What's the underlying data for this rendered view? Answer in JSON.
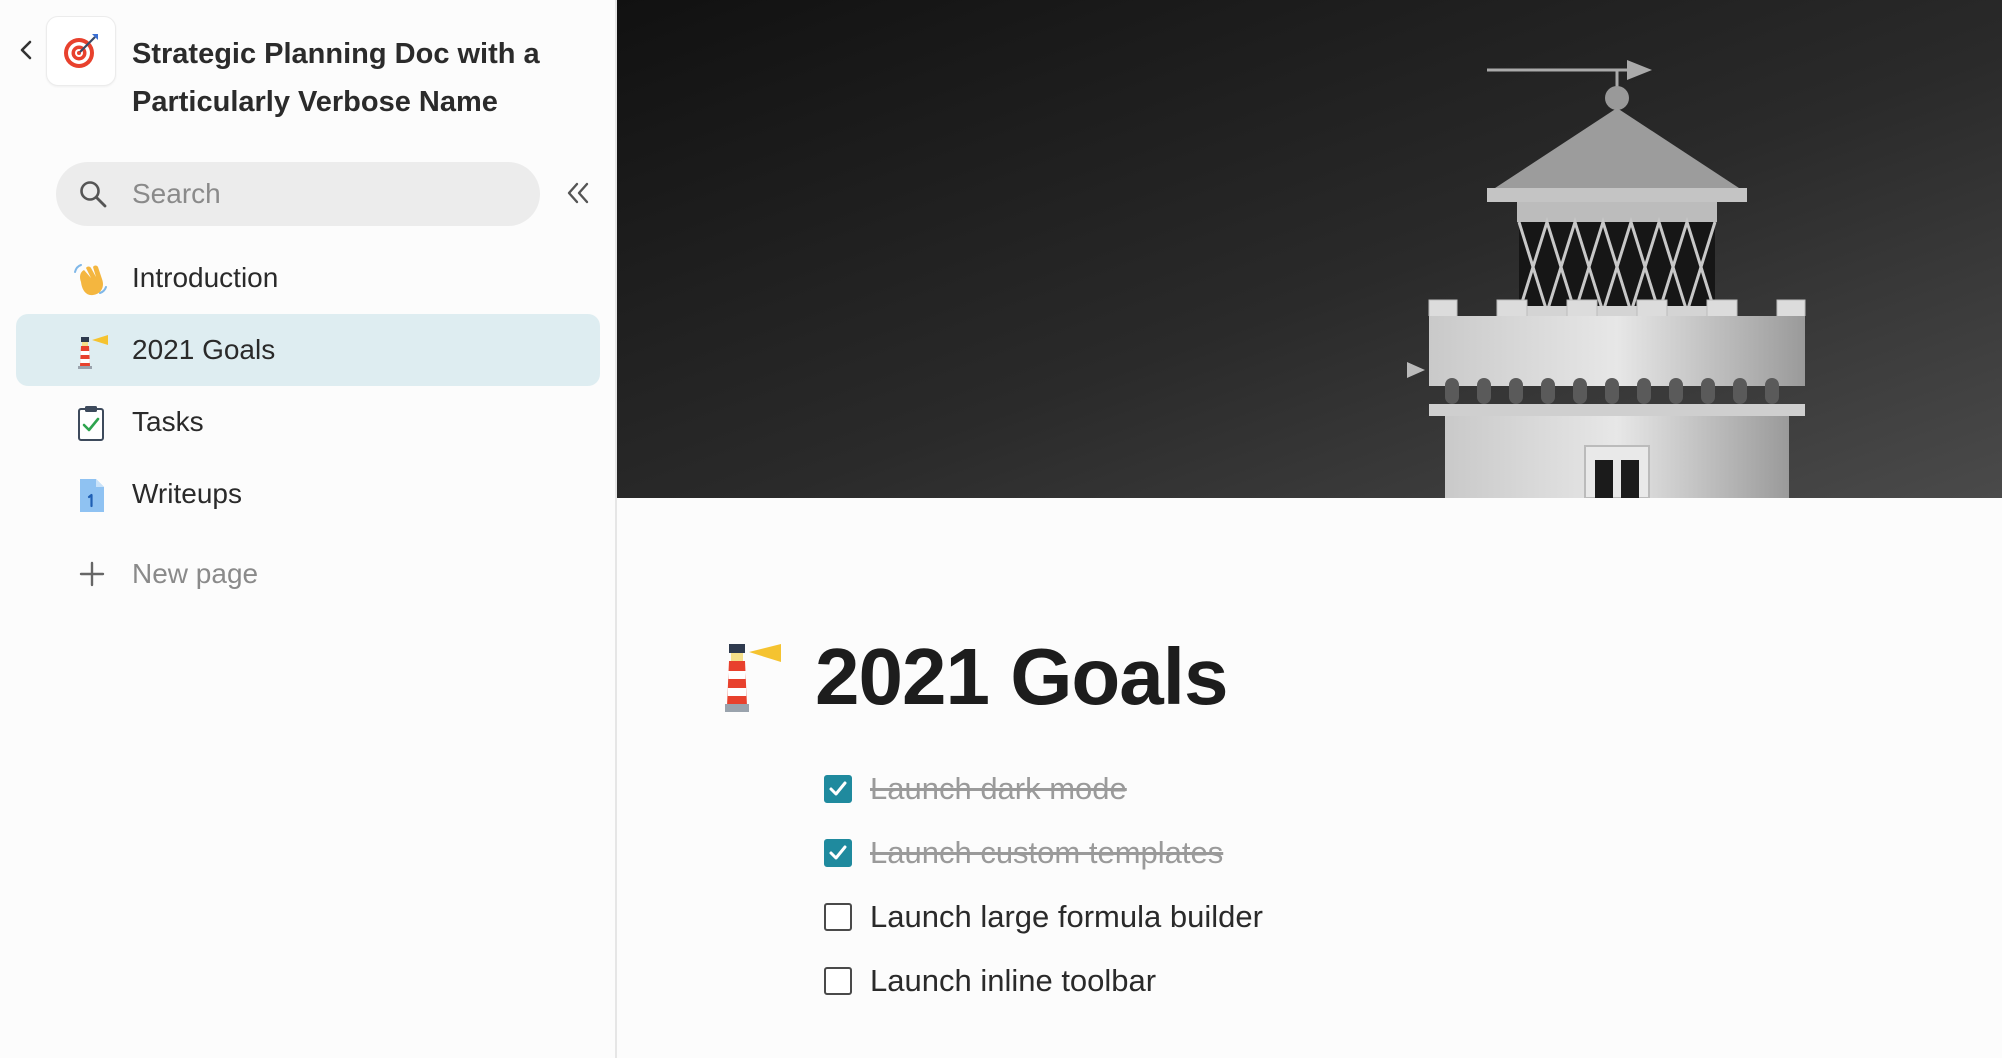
{
  "sidebar": {
    "doc_title": "Strategic Planning Doc with a Particularly Verbose Name",
    "search": {
      "placeholder": "Search"
    },
    "items": [
      {
        "label": "Introduction",
        "icon": "waving-hand-icon",
        "active": false
      },
      {
        "label": "2021 Goals",
        "icon": "lighthouse-icon",
        "active": true
      },
      {
        "label": "Tasks",
        "icon": "clipboard-check-icon",
        "active": false
      },
      {
        "label": "Writeups",
        "icon": "document-icon",
        "active": false
      }
    ],
    "new_page_label": "New page"
  },
  "main": {
    "cover_image": "lighthouse-photo",
    "page_icon": "lighthouse-icon",
    "title": "2021 Goals",
    "todos": [
      {
        "text": "Launch dark mode",
        "checked": true
      },
      {
        "text": "Launch custom templates",
        "checked": true
      },
      {
        "text": "Launch large formula builder",
        "checked": false
      },
      {
        "text": "Launch inline toolbar",
        "checked": false
      }
    ]
  },
  "colors": {
    "accent": "#1f8a9e",
    "active_item_bg": "#deedf1",
    "search_bg": "#ececec"
  }
}
